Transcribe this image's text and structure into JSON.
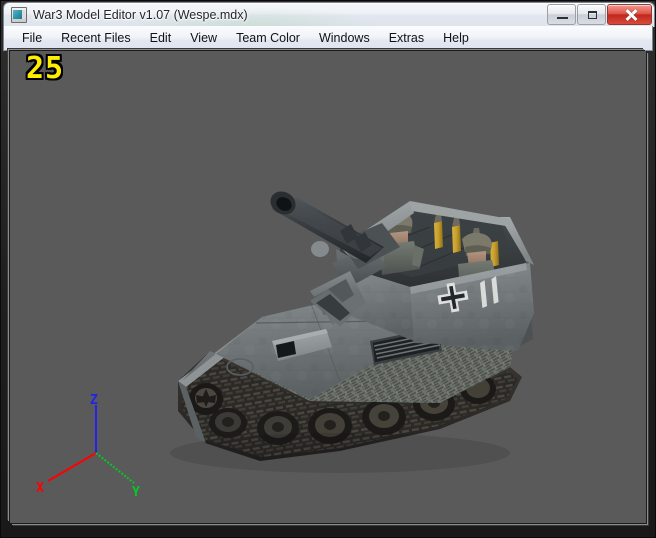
{
  "window": {
    "title": "War3 Model Editor v1.07 (Wespe.mdx)",
    "app_icon": "application-window-icon",
    "controls": {
      "minimize": "minimize-button",
      "maximize": "maximize-button",
      "close": "close-button"
    }
  },
  "menu": {
    "items": [
      {
        "label": "File"
      },
      {
        "label": "Recent Files"
      },
      {
        "label": "Edit"
      },
      {
        "label": "View"
      },
      {
        "label": "Team Color"
      },
      {
        "label": "Windows"
      },
      {
        "label": "Extras"
      },
      {
        "label": "Help"
      }
    ]
  },
  "viewport": {
    "fps": "25",
    "background_color": "#5a5a5a",
    "model_name": "Wespe",
    "axis_gizmo": {
      "x_label": "X",
      "y_label": "Y",
      "z_label": "Z",
      "x_color": "#ff0000",
      "y_color": "#00cc22",
      "z_color": "#2222ee"
    },
    "model_markings": {
      "insignia": "balkenkreuz-iron-cross",
      "vehicle_number": "11"
    }
  },
  "colors": {
    "title_text": "#23262b",
    "menu_text": "#101216",
    "fps_text": "#ffee00",
    "close_button": "#c0281c",
    "frame": "#1f1f1f"
  }
}
